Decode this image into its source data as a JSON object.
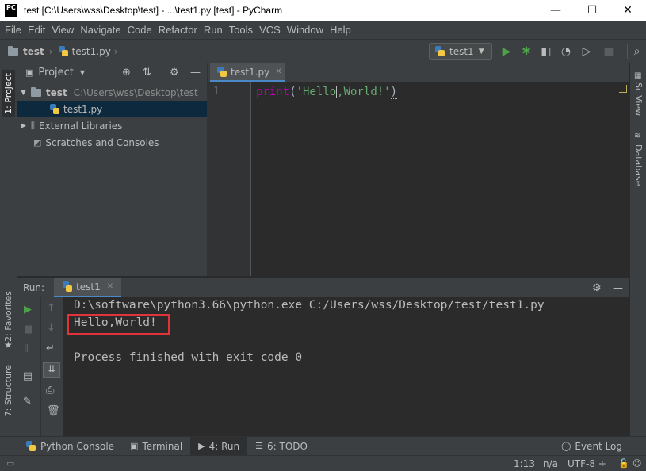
{
  "window": {
    "title": "test [C:\\Users\\wss\\Desktop\\test] - ...\\test1.py [test] - PyCharm",
    "logo_text": "PC",
    "controls": [
      "—",
      "☐",
      "✕"
    ]
  },
  "menu": [
    "File",
    "Edit",
    "View",
    "Navigate",
    "Code",
    "Refactor",
    "Run",
    "Tools",
    "VCS",
    "Window",
    "Help"
  ],
  "breadcrumb": {
    "project": "test",
    "file": "test1.py"
  },
  "run_config": {
    "name": "test1"
  },
  "left_stripe": {
    "project_tab": "1: Project",
    "favorites_tab": "2: Favorites",
    "structure_tab": "7: Structure"
  },
  "right_stripe": {
    "sciview_tab": "SciView",
    "database_tab": "Database"
  },
  "project_panel": {
    "header": "Project",
    "root": {
      "name": "test",
      "path": "C:\\Users\\wss\\Desktop\\test"
    },
    "file": "test1.py",
    "external_libraries": "External Libraries",
    "scratches": "Scratches and Consoles"
  },
  "editor": {
    "tab": "test1.py",
    "line_number": "1",
    "code": {
      "func": "print",
      "open": "(",
      "str_a": "'Hello",
      "comma": ",",
      "str_b": "World!'",
      "close": ")"
    }
  },
  "run_panel": {
    "label": "Run:",
    "tab": "test1",
    "lines": [
      "D:\\software\\python3.66\\python.exe C:/Users/wss/Desktop/test/test1.py",
      "Hello,World!",
      "",
      "Process finished with exit code 0"
    ]
  },
  "bottom_tabs": {
    "python_console": "Python Console",
    "terminal": "Terminal",
    "run": "4: Run",
    "todo": "6: TODO",
    "event_log": "Event Log"
  },
  "status": {
    "position": "1:13",
    "na": "n/a",
    "encoding": "UTF-8 ÷"
  },
  "colors": {
    "accent": "#4a88c7",
    "highlight_box": "#e0333a",
    "keyword": "#b200b2",
    "string": "#6aab73",
    "run_green": "#4ca24b"
  }
}
